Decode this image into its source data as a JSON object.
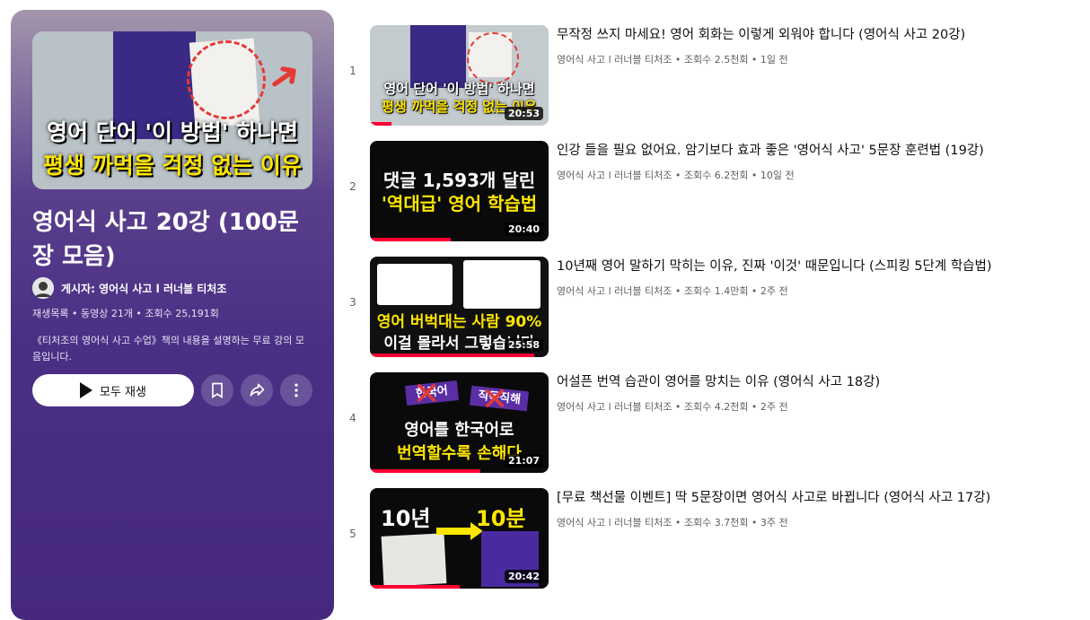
{
  "playlist": {
    "hero_line1": "영어 단어 '이 방법' 하나면",
    "hero_line2": "평생 까먹을 걱정 없는 이유",
    "title": "영어식 사고 20강 (100문장 모음)",
    "owner_label": "게시자: 영어식 사고 l 러너블 티처조",
    "meta": "재생목록 • 동영상 21개 • 조회수 25,191회",
    "description": "《티처조의 영어식 사고 수업》책의 내용을 설명하는 무료 강의 모음입니다.",
    "play_all_label": "모두 재생",
    "accent_color": "#4a2f85"
  },
  "videos": [
    {
      "index": "1",
      "title": "무작정 쓰지 마세요! 영어 회화는 이렇게 외워야 합니다 (영어식 사고 20강)",
      "meta": "영어식 사고 l 러너블 티처조 • 조회수 2.5천회 • 1일 전",
      "duration": "20:53",
      "progress": 0.12,
      "thumb_line1": "영어 단어 '이 방법' 하나면",
      "thumb_line2": "평생 까먹을 걱정 없는 이유"
    },
    {
      "index": "2",
      "title": "인강 들을 필요 없어요. 암기보다 효과 좋은 '영어식 사고' 5문장 훈련법 (19강)",
      "meta": "영어식 사고 l 러너블 티처조 • 조회수 6.2천회 • 10일 전",
      "duration": "20:40",
      "progress": 0.45,
      "thumb_line1": "댓글 1,593개 달린",
      "thumb_line2": "'역대급' 영어 학습법"
    },
    {
      "index": "3",
      "title": "10년째 영어 말하기 막히는 이유, 진짜 '이것' 때문입니다 (스피킹 5단계 학습법)",
      "meta": "영어식 사고 l 러너블 티처조 • 조회수 1.4만회 • 2주 전",
      "duration": "25:58",
      "progress": 0.92,
      "thumb_line1": "영어 버벅대는 사람 90%",
      "thumb_line2": "이걸 몰라서 그렇습니다"
    },
    {
      "index": "4",
      "title": "어설픈 번역 습관이 영어를 망치는 이유 (영어식 사고 18강)",
      "meta": "영어식 사고 l 러너블 티처조 • 조회수 4.2천회 • 2주 전",
      "duration": "21:07",
      "progress": 0.62,
      "thumb_badge1": "한국어",
      "thumb_badge2": "직독직해",
      "thumb_line1": "영어를 한국어로",
      "thumb_line2": "번역할수록 손해다"
    },
    {
      "index": "5",
      "title": "[무료 책선물 이벤트] 딱 5문장이면 영어식 사고로 바뀝니다 (영어식 사고 17강)",
      "meta": "영어식 사고 l 러너블 티처조 • 조회수 3.7천회 • 3주 전",
      "duration": "20:42",
      "progress": 0.5,
      "thumb_line1": "10년",
      "thumb_line2": "10분"
    }
  ]
}
